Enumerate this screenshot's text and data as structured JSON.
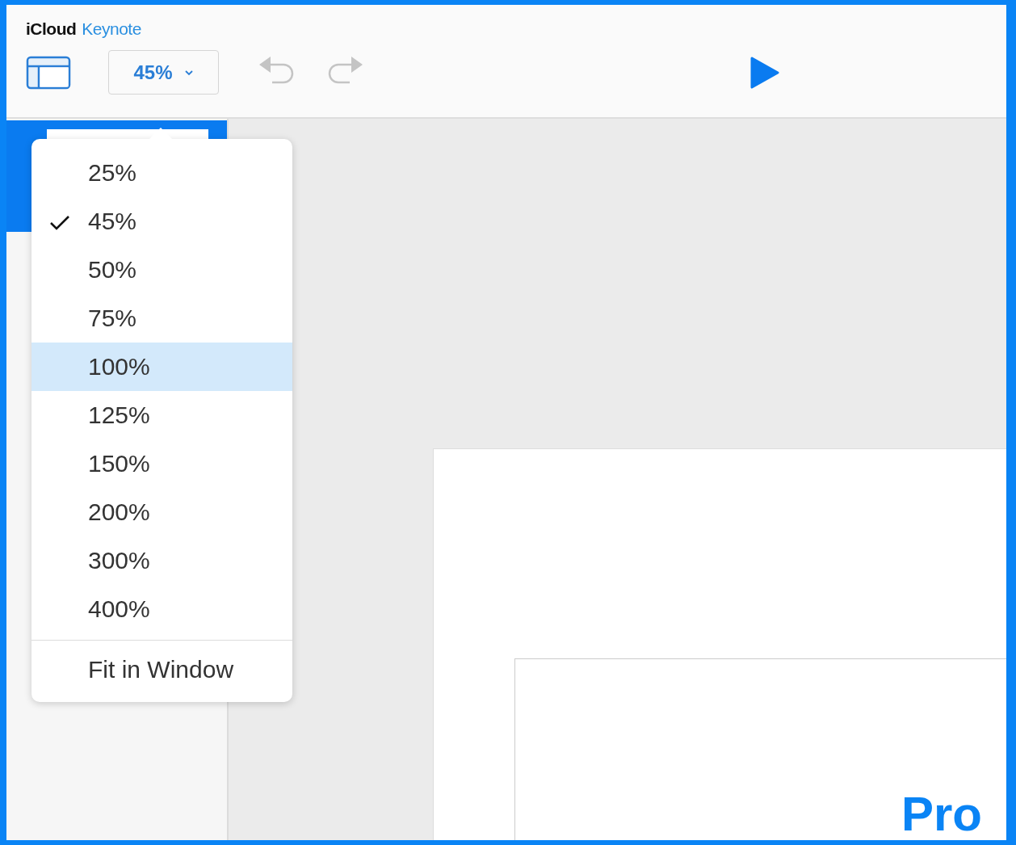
{
  "header": {
    "brand": "iCloud",
    "app": "Keynote"
  },
  "toolbar": {
    "zoom": "45%"
  },
  "zoom_menu": {
    "items": [
      {
        "label": "25%",
        "checked": false,
        "highlighted": false
      },
      {
        "label": "45%",
        "checked": true,
        "highlighted": false
      },
      {
        "label": "50%",
        "checked": false,
        "highlighted": false
      },
      {
        "label": "75%",
        "checked": false,
        "highlighted": false
      },
      {
        "label": "100%",
        "checked": false,
        "highlighted": true
      },
      {
        "label": "125%",
        "checked": false,
        "highlighted": false
      },
      {
        "label": "150%",
        "checked": false,
        "highlighted": false
      },
      {
        "label": "200%",
        "checked": false,
        "highlighted": false
      },
      {
        "label": "300%",
        "checked": false,
        "highlighted": false
      },
      {
        "label": "400%",
        "checked": false,
        "highlighted": false
      }
    ],
    "fit": "Fit in Window"
  },
  "slide": {
    "title": "Pro"
  }
}
